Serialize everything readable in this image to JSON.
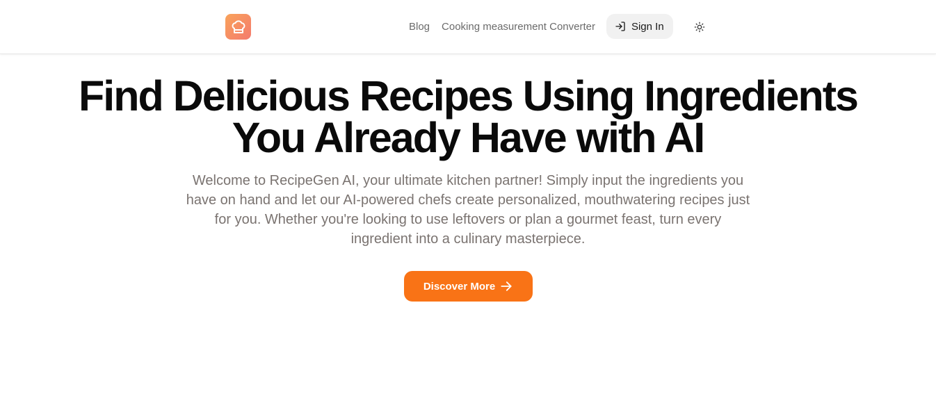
{
  "header": {
    "logo_icon": "chef-hat-icon",
    "nav": {
      "blog_label": "Blog",
      "converter_label": "Cooking measurement Converter",
      "signin_label": "Sign In",
      "signin_icon": "sign-in-icon",
      "theme_icon": "sun-icon"
    }
  },
  "hero": {
    "title_line1": "Find Delicious Recipes Using Ingredients",
    "title_line2": "You Already Have with AI",
    "subtitle": "Welcome to RecipeGen AI, your ultimate kitchen partner! Simply input the ingredients you have on hand and let our AI-powered chefs create personalized, mouthwatering recipes just for you. Whether you're looking to use leftovers or plan a gourmet feast, turn every ingredient into a culinary masterpiece.",
    "cta_label": "Discover More",
    "cta_icon": "arrow-right-icon"
  },
  "colors": {
    "accent": "#f97316",
    "logo_gradient_start": "#f9a35a",
    "logo_gradient_end": "#f47a6e",
    "title": "#0a0a0a",
    "subtitle": "#7a7370"
  }
}
